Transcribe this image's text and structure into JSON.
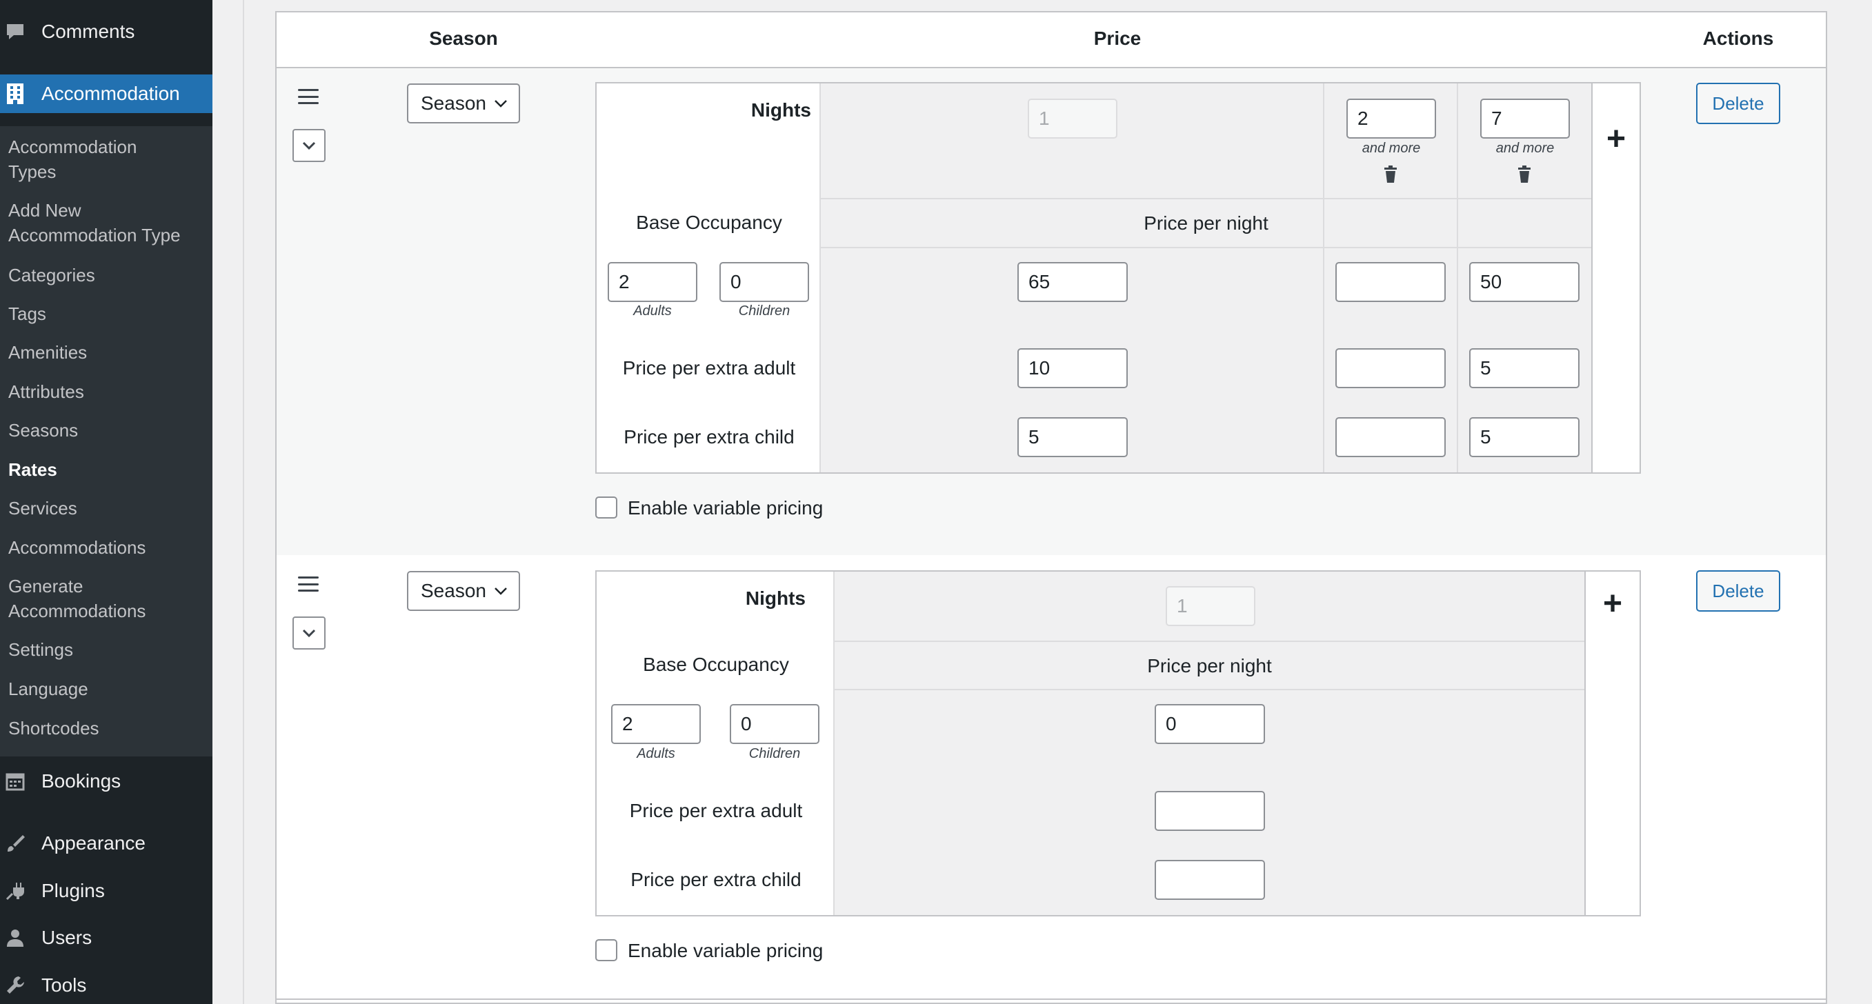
{
  "sidebar": {
    "top_items": [
      {
        "label": "Comments",
        "icon": "comment-icon"
      },
      {
        "label": "Accommodation",
        "icon": "building-icon"
      },
      {
        "label": "Bookings",
        "icon": "calendar-icon"
      },
      {
        "label": "Appearance",
        "icon": "brush-icon"
      },
      {
        "label": "Plugins",
        "icon": "plugin-icon"
      },
      {
        "label": "Users",
        "icon": "user-icon"
      },
      {
        "label": "Tools",
        "icon": "wrench-icon"
      }
    ],
    "submenu": [
      "Accommodation Types",
      "Add New Accommodation Type",
      "Categories",
      "Tags",
      "Amenities",
      "Attributes",
      "Seasons",
      "Rates",
      "Services",
      "Accommodations",
      "Generate Accommodations",
      "Settings",
      "Language",
      "Shortcodes"
    ],
    "submenu_lines": [
      [
        "Accommodation",
        "Types"
      ],
      [
        "Add New",
        "Accommodation Type"
      ],
      [
        "Generate",
        "Accommodations"
      ]
    ],
    "active_submenu": "Rates"
  },
  "table": {
    "headers": {
      "season": "Season",
      "price": "Price",
      "actions": "Actions"
    }
  },
  "rows": [
    {
      "season_select": "Season",
      "nights_label": "Nights",
      "nights": [
        "1",
        "2",
        "7"
      ],
      "and_more": "and more",
      "base_occupancy_label": "Base Occupancy",
      "price_per_night_label": "Price per night",
      "adults": "2",
      "children": "0",
      "adults_caption": "Adults",
      "children_caption": "Children",
      "price_per_night": [
        "65",
        "",
        "50"
      ],
      "extra_adult_label": "Price per extra adult",
      "extra_adult": [
        "10",
        "",
        "5"
      ],
      "extra_child_label": "Price per extra child",
      "extra_child": [
        "5",
        "",
        "5"
      ],
      "variable_pricing_label": "Enable variable pricing",
      "delete_label": "Delete"
    },
    {
      "season_select": "Season",
      "nights_label": "Nights",
      "nights": [
        "1"
      ],
      "base_occupancy_label": "Base Occupancy",
      "price_per_night_label": "Price per night",
      "adults": "2",
      "children": "0",
      "adults_caption": "Adults",
      "children_caption": "Children",
      "price_per_night": [
        "0"
      ],
      "extra_adult_label": "Price per extra adult",
      "extra_adult": [
        ""
      ],
      "extra_child_label": "Price per extra child",
      "extra_child": [
        ""
      ],
      "variable_pricing_label": "Enable variable pricing",
      "delete_label": "Delete"
    }
  ],
  "colors": {
    "accent": "#2271b1",
    "sidebar_bg": "#1d2327",
    "submenu_bg": "#2c3338"
  }
}
